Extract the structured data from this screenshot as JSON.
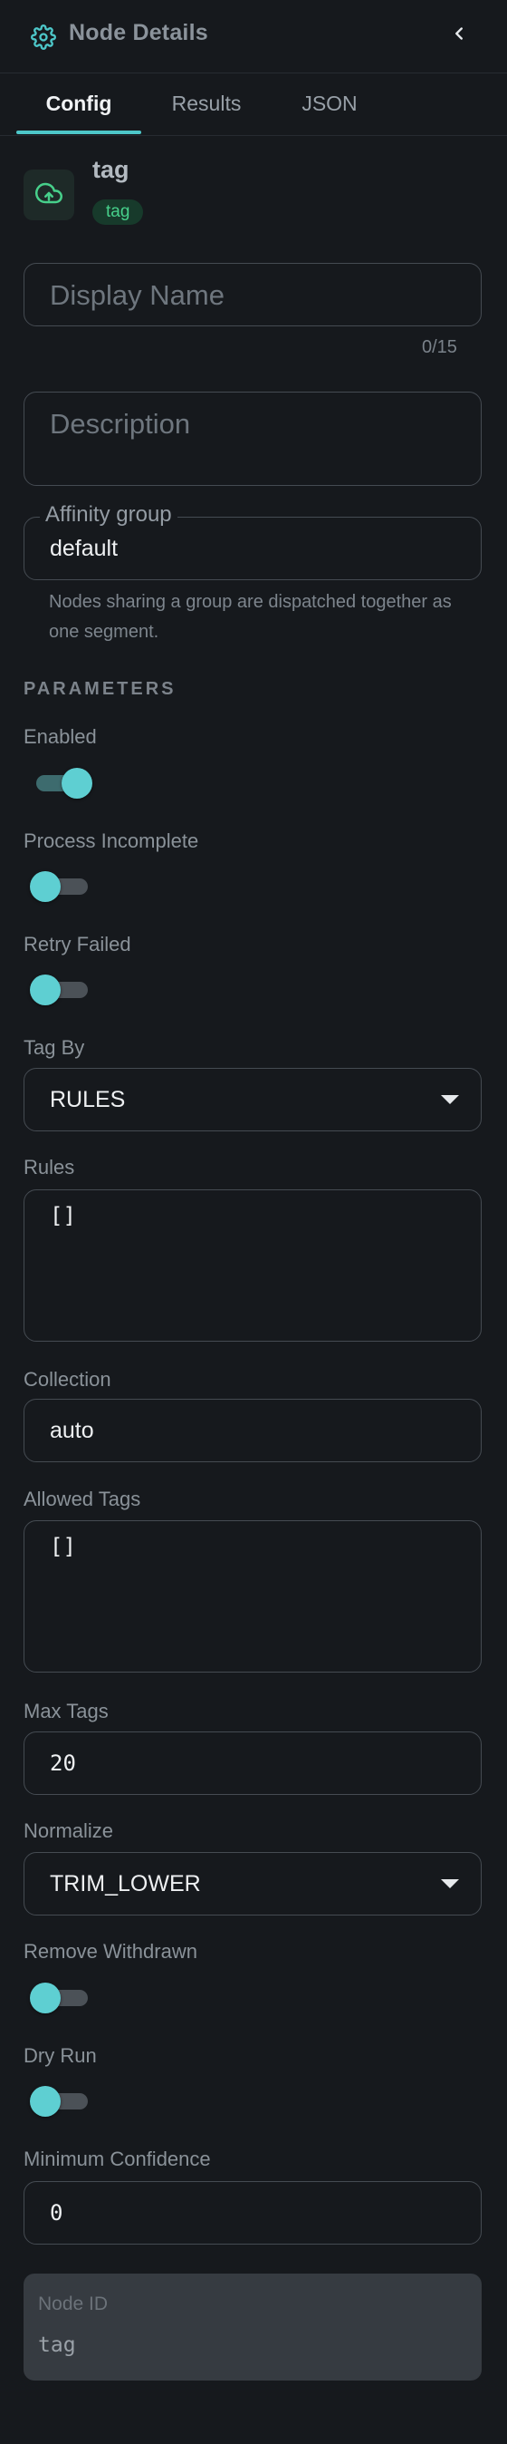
{
  "header": {
    "title": "Node Details",
    "icon": "gear-icon",
    "close_icon": "chevron-left-icon"
  },
  "tabs": [
    {
      "label": "Config",
      "active": true
    },
    {
      "label": "Results",
      "active": false
    },
    {
      "label": "JSON",
      "active": false
    }
  ],
  "node": {
    "name": "tag",
    "type_badge": "tag",
    "icon": "cloud-upload-icon"
  },
  "display_name": {
    "placeholder": "Display Name",
    "value": "",
    "counter": "0/15"
  },
  "description": {
    "placeholder": "Description",
    "value": ""
  },
  "affinity_group": {
    "label": "Affinity group",
    "value": "default",
    "helper": "Nodes sharing a group are dispatched together as one segment."
  },
  "parameters": {
    "heading": "PARAMETERS",
    "enabled": {
      "label": "Enabled",
      "value": true
    },
    "process_incomplete": {
      "label": "Process Incomplete",
      "value": false
    },
    "retry_failed": {
      "label": "Retry Failed",
      "value": false
    },
    "tag_by": {
      "label": "Tag By",
      "value": "RULES"
    },
    "rules": {
      "label": "Rules",
      "value": "[]"
    },
    "collection": {
      "label": "Collection",
      "value": "auto"
    },
    "allowed_tags": {
      "label": "Allowed Tags",
      "value": "[]"
    },
    "max_tags": {
      "label": "Max Tags",
      "value": "20"
    },
    "normalize": {
      "label": "Normalize",
      "value": "TRIM_LOWER"
    },
    "remove_withdrawn": {
      "label": "Remove Withdrawn",
      "value": false
    },
    "dry_run": {
      "label": "Dry Run",
      "value": false
    },
    "minimum_confidence": {
      "label": "Minimum Confidence",
      "value": "0"
    }
  },
  "node_id": {
    "label": "Node ID",
    "value": "tag"
  },
  "colors": {
    "background": "#16191d",
    "accent": "#4dc7c9",
    "badge_bg": "#173a2b",
    "badge_text": "#47d08b",
    "border": "#454b52"
  }
}
